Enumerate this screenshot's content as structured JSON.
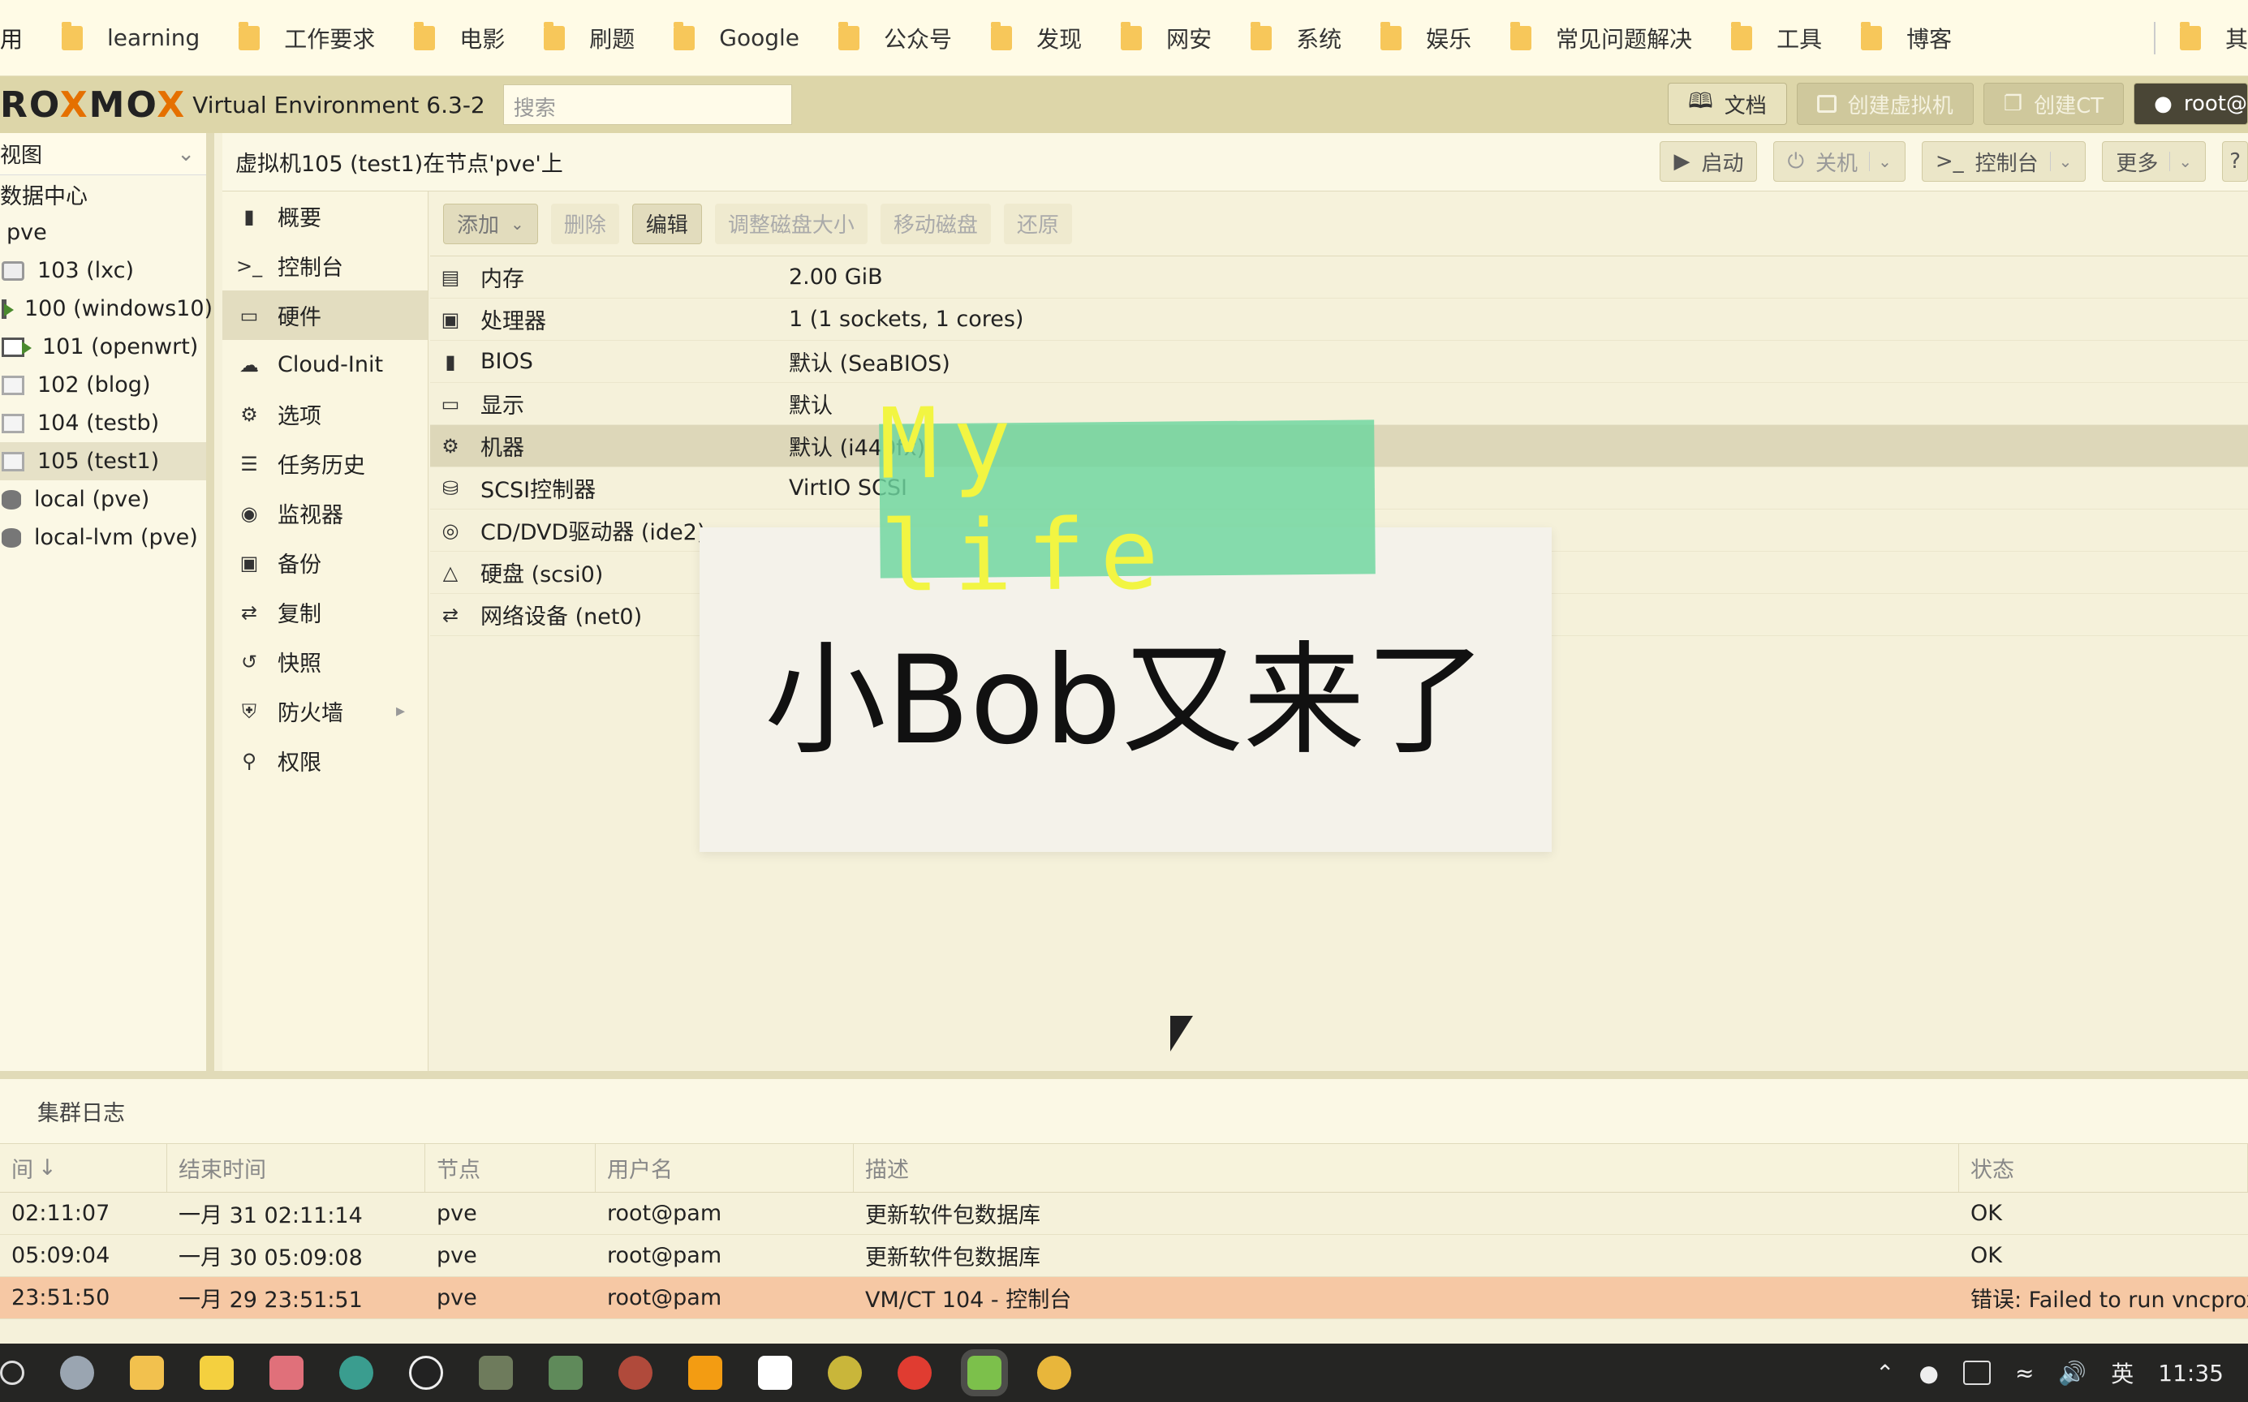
{
  "bookmarks": {
    "first_fragment": "用",
    "items": [
      "learning",
      "工作要求",
      "电影",
      "刷题",
      "Google",
      "公众号",
      "发现",
      "网安",
      "系统",
      "娱乐",
      "常见问题解决",
      "工具",
      "博客"
    ],
    "overflow_label": "其"
  },
  "header": {
    "logo_left": "RO",
    "logo_x": "X",
    "logo_right": "MO",
    "logo_x2": "X",
    "product": "Virtual Environment 6.3-2",
    "search_placeholder": "搜索",
    "docs_label": "文档",
    "create_vm_label": "创建虚拟机",
    "create_ct_label": "创建CT",
    "user_label": "root@"
  },
  "tree": {
    "view_label": "视图",
    "root": "数据中心",
    "node": "pve",
    "items": [
      {
        "label": "103 (lxc)",
        "kind": "ct"
      },
      {
        "label": "100 (windows10)",
        "kind": "vm-run"
      },
      {
        "label": "101 (openwrt)",
        "kind": "vm-run"
      },
      {
        "label": "102 (blog)",
        "kind": "vm-off"
      },
      {
        "label": "104 (testb)",
        "kind": "vm-off"
      },
      {
        "label": "105 (test1)",
        "kind": "vm-off"
      },
      {
        "label": "local (pve)",
        "kind": "storage"
      },
      {
        "label": "local-lvm (pve)",
        "kind": "storage"
      }
    ]
  },
  "content_header": {
    "title": "虚拟机105 (test1)在节点'pve'上",
    "start_label": "启动",
    "shutdown_label": "关机",
    "console_label": "控制台",
    "more_label": "更多"
  },
  "nav": {
    "items": [
      "概要",
      "控制台",
      "硬件",
      "Cloud-Init",
      "选项",
      "任务历史",
      "监视器",
      "备份",
      "复制",
      "快照",
      "防火墙",
      "权限"
    ],
    "selected": "硬件"
  },
  "toolbar": {
    "add_label": "添加",
    "remove_label": "删除",
    "edit_label": "编辑",
    "resize_label": "调整磁盘大小",
    "move_label": "移动磁盘",
    "revert_label": "还原"
  },
  "hardware": [
    {
      "key": "内存",
      "value": "2.00 GiB",
      "icon": "memory-icon"
    },
    {
      "key": "处理器",
      "value": "1 (1 sockets, 1 cores)",
      "icon": "cpu-icon"
    },
    {
      "key": "BIOS",
      "value": "默认 (SeaBIOS)",
      "icon": "bios-icon"
    },
    {
      "key": "显示",
      "value": "默认",
      "icon": "display-icon"
    },
    {
      "key": "机器",
      "value": "默认 (i440fx)",
      "icon": "machine-icon"
    },
    {
      "key": "SCSI控制器",
      "value": "VirtIO SCSI",
      "icon": "scsi-icon"
    },
    {
      "key": "CD/DVD驱动器 (ide2)",
      "value": "",
      "icon": "cdrom-icon"
    },
    {
      "key": "硬盘 (scsi0)",
      "value": "",
      "icon": "harddisk-icon"
    },
    {
      "key": "网络设备 (net0)",
      "value": "",
      "icon": "network-icon"
    }
  ],
  "overlay": {
    "tape_text": "My life",
    "sticker_text": "小Bob又来了"
  },
  "log": {
    "tab_label": "集群日志",
    "columns": [
      "间",
      "结束时间",
      "节点",
      "用户名",
      "描述",
      "状态"
    ],
    "rows": [
      {
        "start": "02:11:07",
        "end": "一月 31 02:11:14",
        "node": "pve",
        "user": "root@pam",
        "desc": "更新软件包数据库",
        "status": "OK"
      },
      {
        "start": "05:09:04",
        "end": "一月 30 05:09:08",
        "node": "pve",
        "user": "root@pam",
        "desc": "更新软件包数据库",
        "status": "OK"
      },
      {
        "start": "23:51:50",
        "end": "一月 29 23:51:51",
        "node": "pve",
        "user": "root@pam",
        "desc": "VM/CT 104 - 控制台",
        "status": "错误: Failed to run vncproxy"
      }
    ]
  },
  "taskbar": {
    "clock": "11:35",
    "ime": "英"
  }
}
